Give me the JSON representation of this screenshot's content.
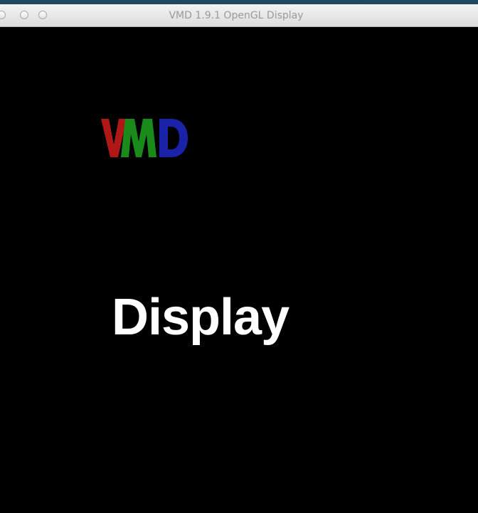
{
  "window": {
    "title": "VMD 1.9.1 OpenGL Display"
  },
  "canvas": {
    "background": "#000000",
    "logo": {
      "letters": [
        "V",
        "M",
        "D"
      ],
      "colors": [
        "#b01818",
        "#1a8a1a",
        "#1a23a8"
      ]
    },
    "label": "Display"
  }
}
